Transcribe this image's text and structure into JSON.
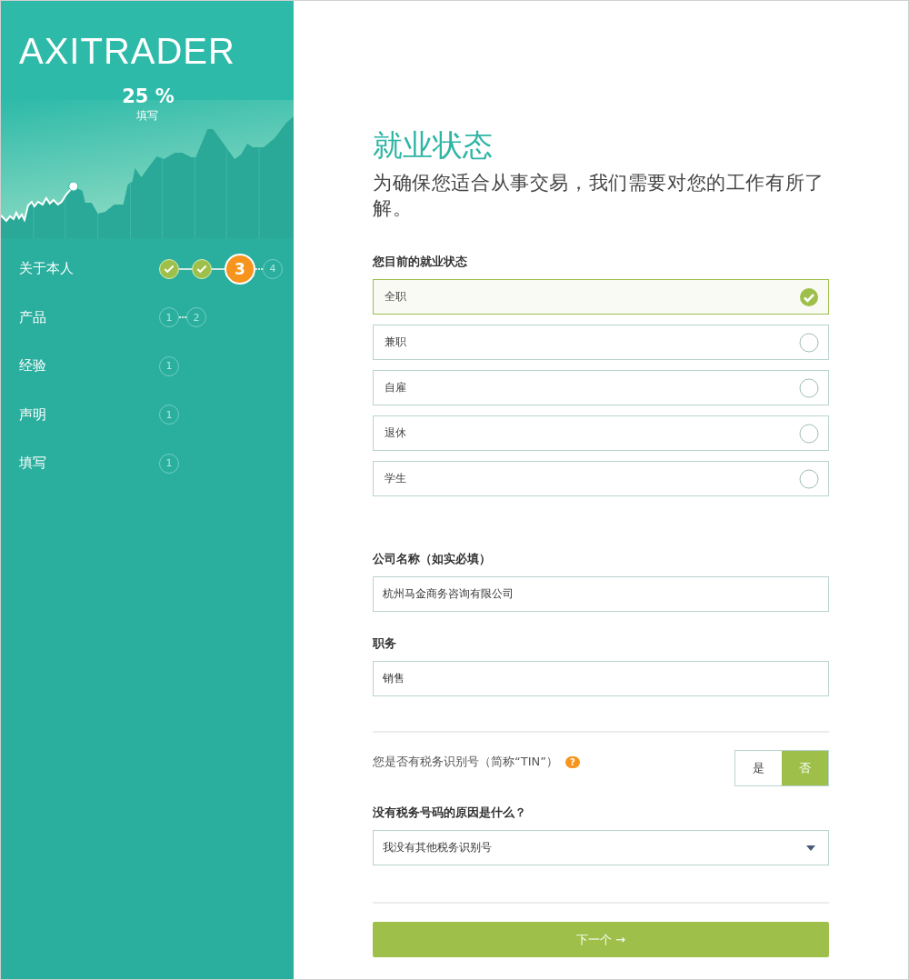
{
  "sidebar": {
    "logo": "AXITRADER",
    "progress": {
      "percent": "25 %",
      "label": "填写"
    },
    "sections": [
      {
        "name": "关于本人",
        "steps": [
          {
            "kind": "done"
          },
          {
            "kind": "done"
          },
          {
            "kind": "current",
            "label": "3"
          },
          {
            "kind": "pending",
            "label": "4"
          }
        ]
      },
      {
        "name": "产品",
        "steps": [
          {
            "kind": "pending",
            "label": "1"
          },
          {
            "kind": "pending",
            "label": "2"
          }
        ]
      },
      {
        "name": "经验",
        "steps": [
          {
            "kind": "pending",
            "label": "1"
          }
        ]
      },
      {
        "name": "声明",
        "steps": [
          {
            "kind": "pending",
            "label": "1"
          }
        ]
      },
      {
        "name": "填写",
        "steps": [
          {
            "kind": "pending",
            "label": "1"
          }
        ]
      }
    ]
  },
  "form": {
    "title": "就业状态",
    "subtitle": "为确保您适合从事交易，我们需要对您的工作有所了解。",
    "employment": {
      "label": "您目前的就业状态",
      "options": [
        {
          "label": "全职",
          "selected": true
        },
        {
          "label": "兼职",
          "selected": false
        },
        {
          "label": "自雇",
          "selected": false
        },
        {
          "label": "退休",
          "selected": false
        },
        {
          "label": "学生",
          "selected": false
        }
      ]
    },
    "company": {
      "label": "公司名称（如实必填）",
      "value": "杭州马金商务咨询有限公司"
    },
    "position": {
      "label": "职务",
      "value": "销售"
    },
    "tin": {
      "question": "您是否有税务识别号（简称“TIN”）",
      "help": "?",
      "options": [
        {
          "label": "是",
          "selected": false
        },
        {
          "label": "否",
          "selected": true
        }
      ]
    },
    "reason": {
      "label": "没有税务号码的原因是什么？",
      "value": "我没有其他税务识别号"
    },
    "next_button": "下一个 →"
  }
}
